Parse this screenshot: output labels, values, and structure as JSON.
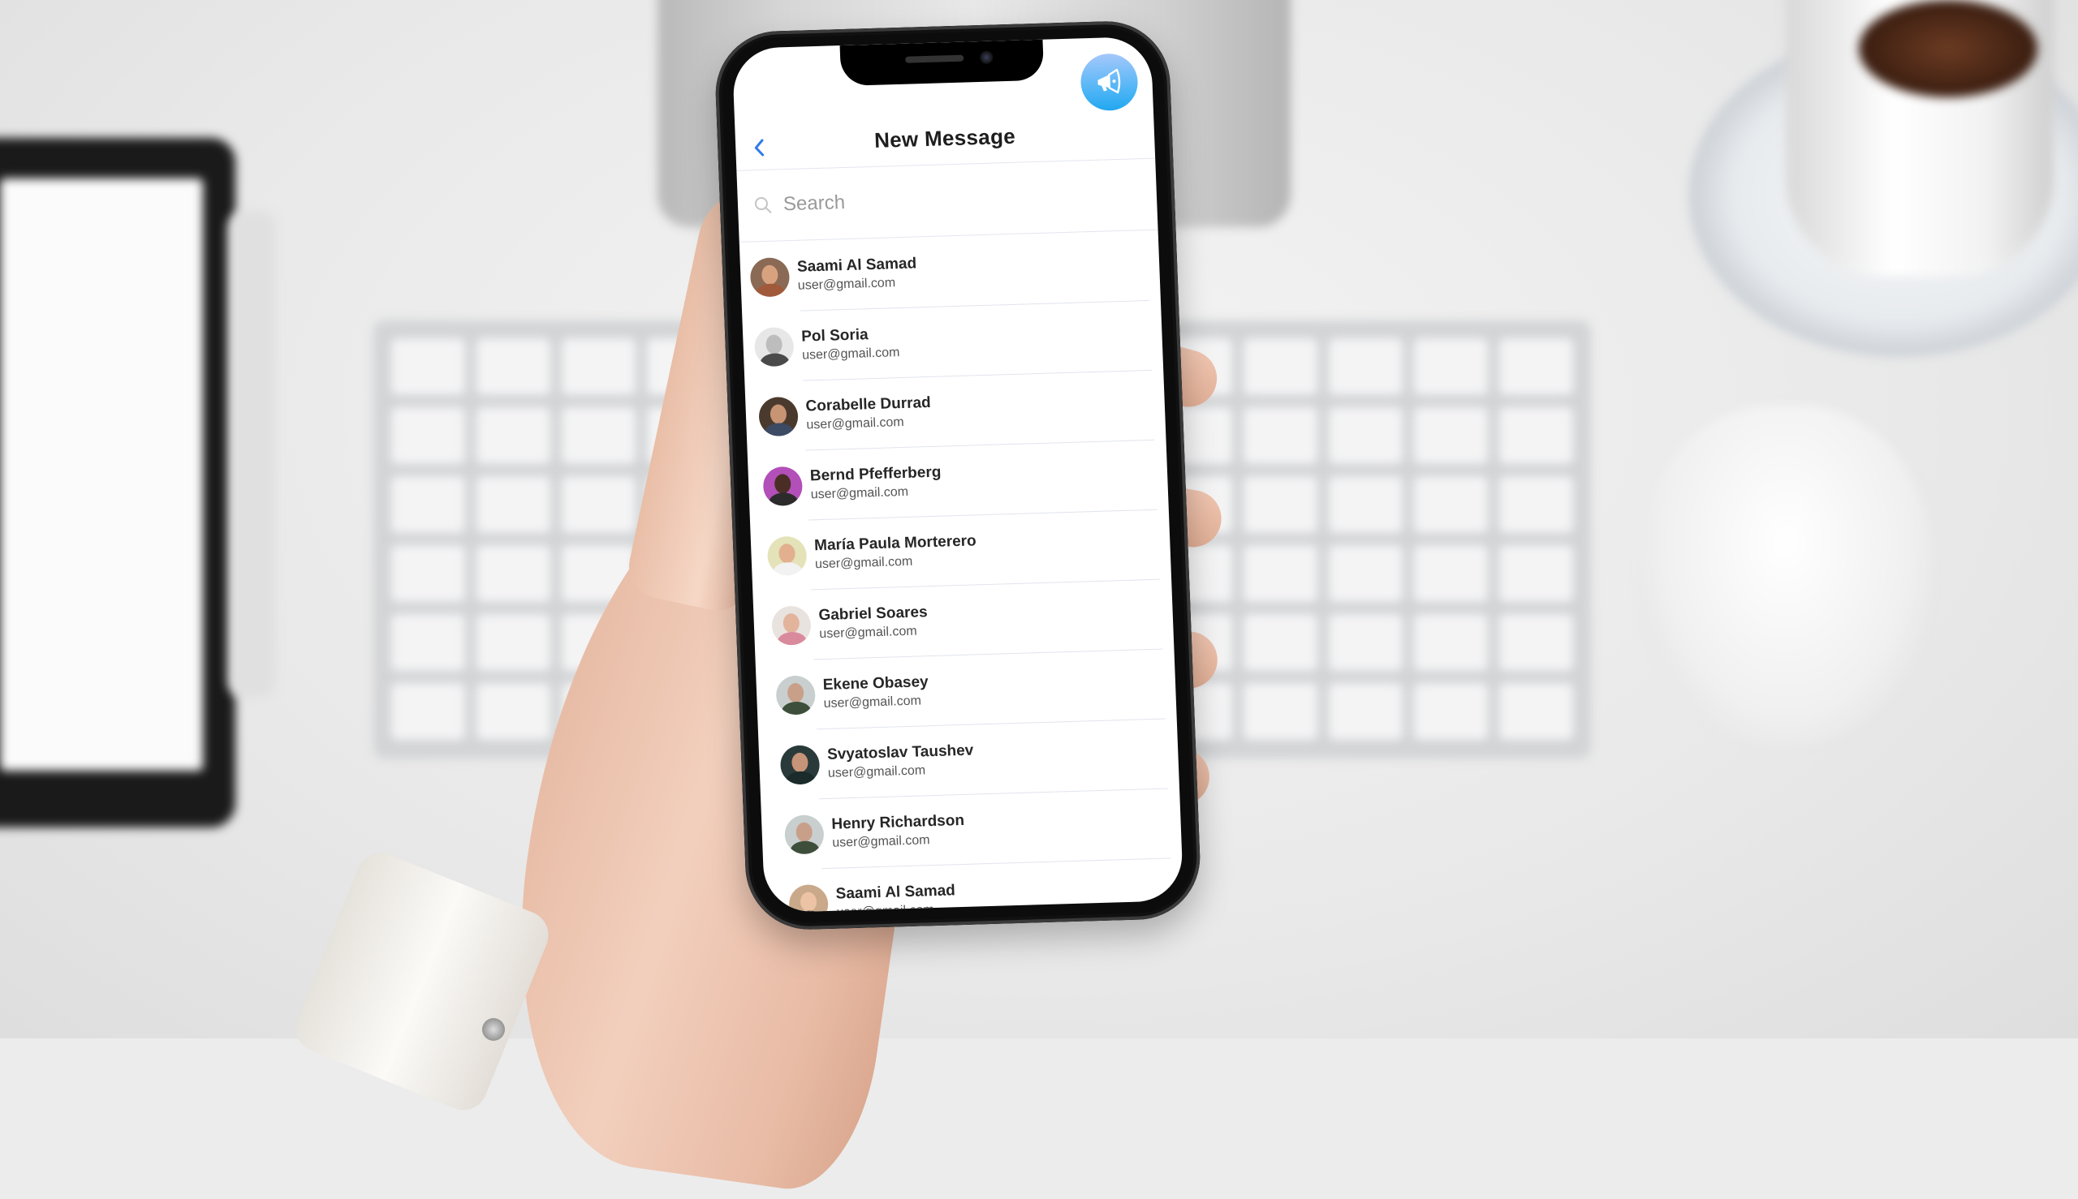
{
  "app": {
    "screen_title": "New Message",
    "back_label": "‹",
    "broadcast_icon": "megaphone-icon",
    "accent_color": "#2f7be8",
    "broadcast_gradient": [
      "#a5c8fb",
      "#22a7f0"
    ]
  },
  "search": {
    "placeholder": "Search",
    "value": "",
    "icon": "search-icon"
  },
  "contacts": [
    {
      "name": "Saami Al Samad",
      "email": "user@gmail.com",
      "avatar": {
        "bg": "#8a6a55",
        "skin": "#d9a27f",
        "shirt": "#a05a3a"
      }
    },
    {
      "name": "Pol Soria",
      "email": "user@gmail.com",
      "avatar": {
        "bg": "#e7e7e7",
        "skin": "#bdbdbd",
        "shirt": "#4a4a4a"
      }
    },
    {
      "name": "Corabelle Durrad",
      "email": "user@gmail.com",
      "avatar": {
        "bg": "#4a3a2e",
        "skin": "#c79474",
        "shirt": "#3c4a63"
      }
    },
    {
      "name": "Bernd Pfefferberg",
      "email": "user@gmail.com",
      "avatar": {
        "bg": "#b24fb8",
        "skin": "#4a2e25",
        "shirt": "#2b2b2b"
      }
    },
    {
      "name": "María Paula Morterero",
      "email": "user@gmail.com",
      "avatar": {
        "bg": "#e4e2b8",
        "skin": "#e2b08f",
        "shirt": "#f2f2f2"
      }
    },
    {
      "name": "Gabriel Soares",
      "email": "user@gmail.com",
      "avatar": {
        "bg": "#e9e3e0",
        "skin": "#e3b49c",
        "shirt": "#d98a9c"
      }
    },
    {
      "name": "Ekene Obasey",
      "email": "user@gmail.com",
      "avatar": {
        "bg": "#c9cfcf",
        "skin": "#c8a08a",
        "shirt": "#3d4f3a"
      }
    },
    {
      "name": "Svyatoslav Taushev",
      "email": "user@gmail.com",
      "avatar": {
        "bg": "#2a3a3a",
        "skin": "#c69478",
        "shirt": "#1b2a2a"
      }
    },
    {
      "name": "Henry Richardson",
      "email": "user@gmail.com",
      "avatar": {
        "bg": "#c9cfcf",
        "skin": "#c8a08a",
        "shirt": "#3d4f3a"
      }
    },
    {
      "name": "Saami Al Samad",
      "email": "user@gmail.com",
      "avatar": {
        "bg": "#c9a98a",
        "skin": "#ecc3a4",
        "shirt": "#3a3a3a"
      }
    }
  ]
}
